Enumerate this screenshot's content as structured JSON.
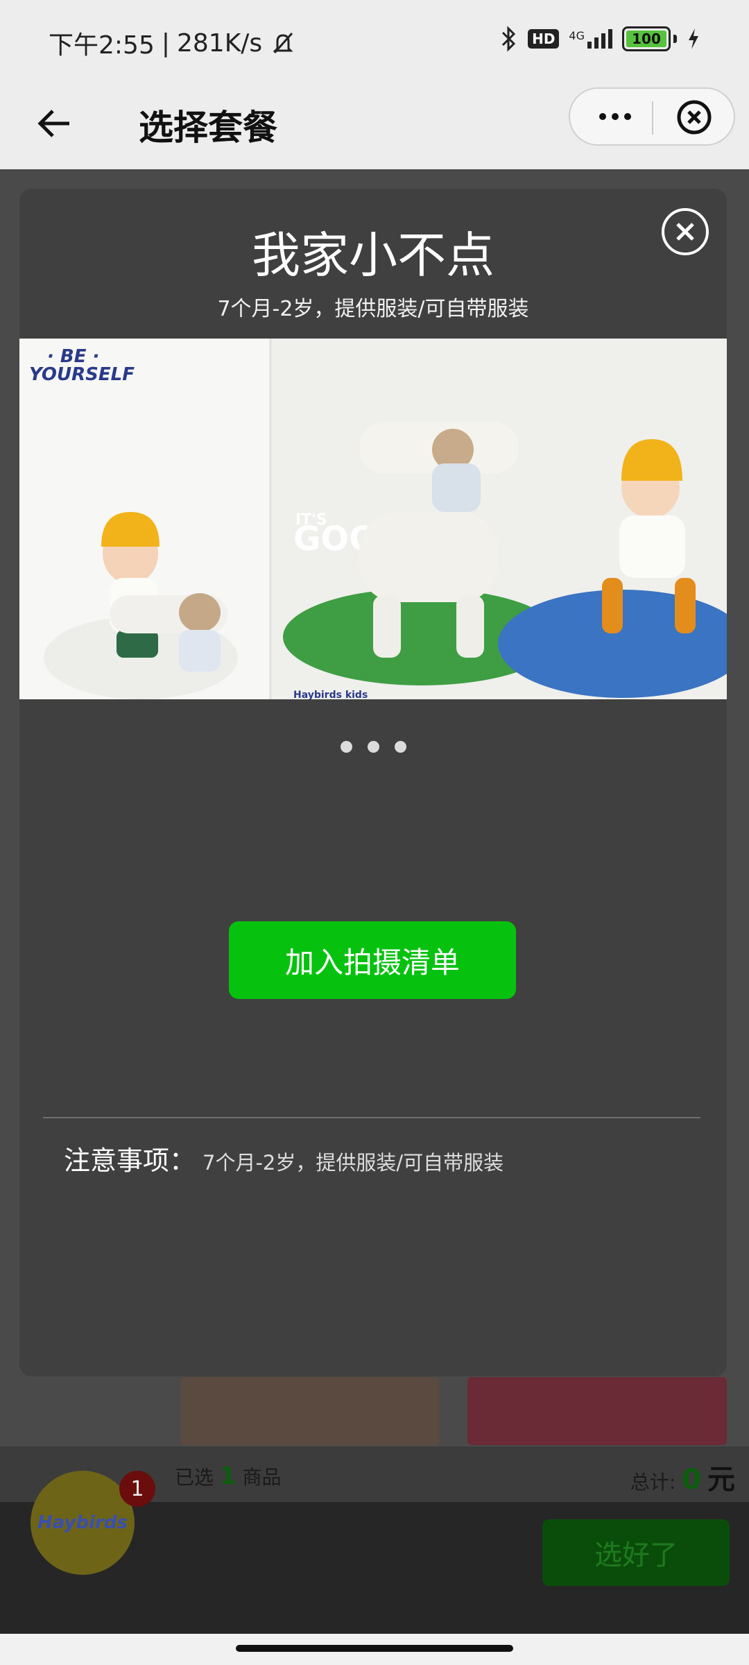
{
  "status_bar": {
    "time": "下午2:55",
    "network_speed": "281K/s",
    "hd_badge": "HD",
    "network_type": "4G",
    "battery_level": "100",
    "icons": [
      "mute-bell-icon",
      "bluetooth-icon",
      "signal-icon",
      "battery-icon",
      "charging-icon"
    ]
  },
  "nav": {
    "title": "选择套餐",
    "icons": [
      "back-arrow-icon",
      "more-icon",
      "close-circle-icon"
    ]
  },
  "modal": {
    "title": "我家小不点",
    "subtitle": "7个月-2岁，提供服装/可自带服装",
    "hero": {
      "text_be": "· BE ·",
      "text_yourself": "YOURSELF",
      "text_its": "IT'S",
      "text_goodboy": "GOODBOY",
      "brand": "Haybirds kids"
    },
    "carousel_pages": 3,
    "carousel_active": 2,
    "add_button": "加入拍摄清单",
    "notes_label": "注意事项：",
    "notes_text": "7个月-2岁，提供服装/可自带服装"
  },
  "background": {
    "selected_prefix": "已选",
    "selected_count": "1",
    "selected_suffix": "商品",
    "cart_badge": "1",
    "total_label": "总计:",
    "total_value": "0",
    "total_unit": "元",
    "confirm_button": "选好了",
    "logo_text": "Haybirds"
  },
  "colors": {
    "accent_green": "#06c20f",
    "overlay": "#404040",
    "navbar_bg": "#ededed"
  }
}
